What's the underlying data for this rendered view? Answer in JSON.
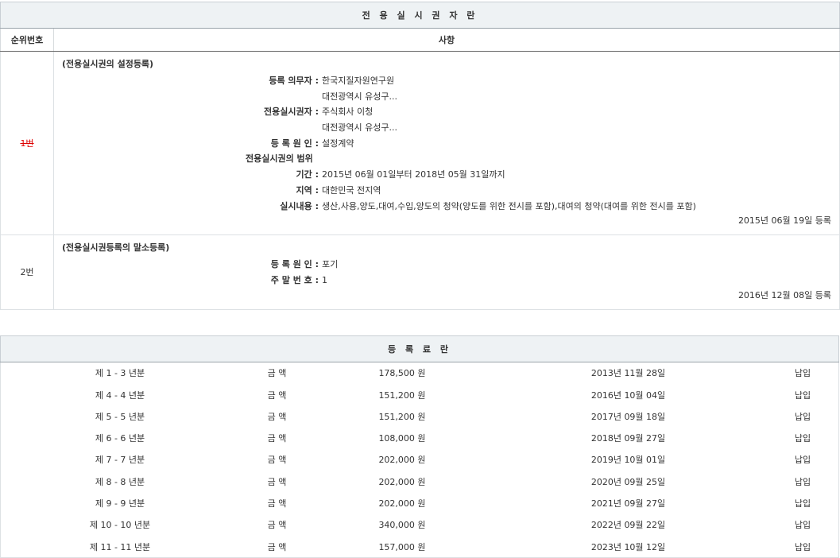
{
  "exclusive_license": {
    "title": "전 용 실 시 권 자 란",
    "col_number": "순위번호",
    "col_matters": "사항",
    "entries": [
      {
        "number": "1번",
        "struck": true,
        "heading": "(전용실시권의 설정등록)",
        "obligor_label": "등록 의무자 :",
        "obligor_name": "한국지질자원연구원",
        "obligor_addr": "대전광역시 유성구...",
        "licensee_label": "전용실시권자 :",
        "licensee_name": "주식회사 이청",
        "licensee_addr": "대전광역시 유성구...",
        "cause_label": "등 록 원 인 :",
        "cause_value": "설정계약",
        "scope_label": "전용실시권의 범위",
        "period_label": "기간 :",
        "period_value": "2015년 06월 01일부터 2018년 05월 31일까지",
        "region_label": "지역 :",
        "region_value": "대한민국 전지역",
        "content_label": "실시내용 :",
        "content_value": "생산,사용,양도,대여,수입,양도의 청약(양도를 위한 전시를 포함),대여의 청약(대여를 위한 전시를 포함)",
        "reg_date": "2015년 06월 19일 등록"
      },
      {
        "number": "2번",
        "struck": false,
        "heading": "(전용실시권등록의 말소등록)",
        "cause_label": "등 록 원 인 :",
        "cause_value": "포기",
        "erasure_label": "주 말 번 호 :",
        "erasure_value": "1",
        "reg_date": "2016년 12월 08일 등록"
      }
    ]
  },
  "fees": {
    "title": "등 록 료 란",
    "rows": [
      {
        "period": "제 1 - 3 년분",
        "kind": "금 액",
        "amount": "178,500 원",
        "date": "2013년 11월 28일",
        "status": "납입"
      },
      {
        "period": "제 4 - 4 년분",
        "kind": "금 액",
        "amount": "151,200 원",
        "date": "2016년 10월 04일",
        "status": "납입"
      },
      {
        "period": "제 5 - 5 년분",
        "kind": "금 액",
        "amount": "151,200 원",
        "date": "2017년 09월 18일",
        "status": "납입"
      },
      {
        "period": "제 6 - 6 년분",
        "kind": "금 액",
        "amount": "108,000 원",
        "date": "2018년 09월 27일",
        "status": "납입"
      },
      {
        "period": "제 7 - 7 년분",
        "kind": "금 액",
        "amount": "202,000 원",
        "date": "2019년 10월 01일",
        "status": "납입"
      },
      {
        "period": "제 8 - 8 년분",
        "kind": "금 액",
        "amount": "202,000 원",
        "date": "2020년 09월 25일",
        "status": "납입"
      },
      {
        "period": "제 9 - 9 년분",
        "kind": "금 액",
        "amount": "202,000 원",
        "date": "2021년 09월 27일",
        "status": "납입"
      },
      {
        "period": "제 10 - 10 년분",
        "kind": "금 액",
        "amount": "340,000 원",
        "date": "2022년 09월 22일",
        "status": "납입"
      },
      {
        "period": "제 11 - 11 년분",
        "kind": "금 액",
        "amount": "157,000 원",
        "date": "2023년 10월 12일",
        "status": "납입"
      }
    ]
  }
}
